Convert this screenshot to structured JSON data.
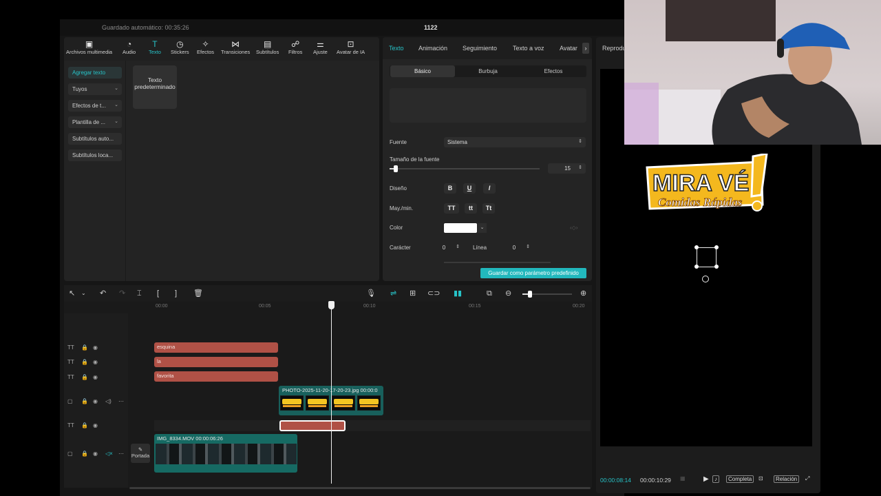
{
  "header": {
    "autosave": "Guardado automático: 00:35:26",
    "project": "1122"
  },
  "toolbar": [
    "Archivos multimedia",
    "Audio",
    "Texto",
    "Stickers",
    "Efectos",
    "Transiciones",
    "Subtítulos",
    "Filtros",
    "Ajuste",
    "Avatar de IA"
  ],
  "sidebar": {
    "add": "Agregar texto",
    "yours": "Tuyos",
    "effects": "Efectos de t...",
    "template": "Plantilla de ...",
    "autosub": "Subtítulos auto...",
    "localsub": "Subtítulos loca..."
  },
  "template_card": "Texto predeterminado",
  "props": {
    "tabs": [
      "Texto",
      "Animación",
      "Seguimiento",
      "Texto a voz",
      "Avatar"
    ],
    "subtabs": [
      "Básico",
      "Burbuja",
      "Efectos"
    ],
    "font_label": "Fuente",
    "font_value": "Sistema",
    "size_label": "Tamaño de la fuente",
    "size_value": "15",
    "design_label": "Diseño",
    "case_label": "May./min.",
    "color_label": "Color",
    "color_value": "#ffffff",
    "char_label": "Carácter",
    "char_value": "0",
    "line_label": "Línea",
    "line_value": "0",
    "save_preset": "Guardar como parámetro predefinido"
  },
  "timeline": {
    "ticks": [
      "00:00",
      "00:05",
      "00:10",
      "00:15",
      "00:20"
    ],
    "text_clips": [
      "esquina",
      "la",
      "favorita"
    ],
    "photo_clip": "PHOTO-2025-11-20-17-20-23.jpg  00:00:0",
    "video_clip": "IMG_8334.MOV  00:00:06:26",
    "cover": "Portada"
  },
  "preview": {
    "title": "Reprodu",
    "logo_line1": "MIRA VÉ",
    "logo_line2": "Comidas Rápidas",
    "time_current": "00:00:08:14",
    "time_total": "00:00:10:29",
    "complete": "Completa",
    "ratio": "Relación"
  }
}
